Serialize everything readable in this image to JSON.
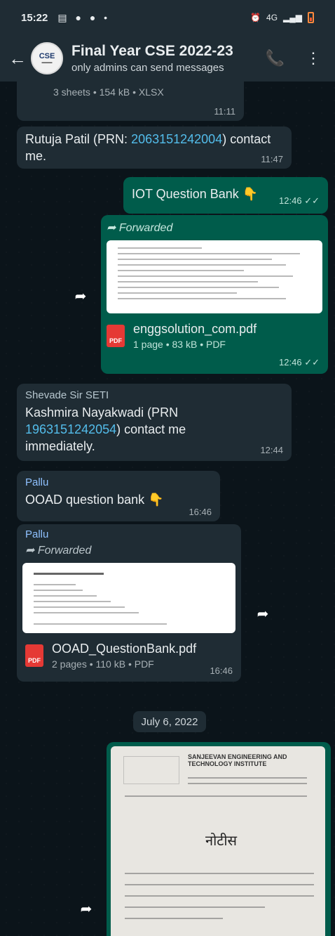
{
  "status_bar": {
    "time": "15:22",
    "notif_icons": "▤ ● ● •",
    "network": "4G"
  },
  "header": {
    "group_name": "Final Year CSE 2022-23",
    "subtitle": "only admins can send messages",
    "avatar_text": "CSE"
  },
  "messages": {
    "m1": {
      "info": "3 sheets • 154 kB • XLSX",
      "time": "11:11"
    },
    "m2": {
      "text_a": "Rutuja Patil (PRN: ",
      "prn": "2063151242004",
      "text_b": ") contact me.",
      "time": "11:47"
    },
    "m3": {
      "text": "IOT Question Bank 👇",
      "time": "12:46"
    },
    "m4": {
      "forwarded": "Forwarded",
      "filename": "enggsolution_com.pdf",
      "info": "1 page • 83 kB • PDF",
      "time": "12:46"
    },
    "m5": {
      "sender": "Shevade Sir SETI",
      "text_a": "Kashmira Nayakwadi (PRN ",
      "prn": "1963151242054",
      "text_b": ") contact me immediately.",
      "time": "12:44"
    },
    "m6": {
      "sender": "Pallu",
      "text": "OOAD question bank 👇",
      "time": "16:46"
    },
    "m7": {
      "sender": "Pallu",
      "forwarded": "Forwarded",
      "filename": "OOAD_QuestionBank.pdf",
      "info": "2 pages • 110 kB • PDF",
      "time": "16:46"
    }
  },
  "date_separator": "July 6, 2022",
  "notice": {
    "institute": "SANJEEVAN ENGINEERING AND TECHNOLOGY INSTITUTE",
    "title": "नोटीस"
  },
  "labels": {
    "pdf": "PDF",
    "forward_arrow": "➦",
    "ticks": "✓✓"
  }
}
